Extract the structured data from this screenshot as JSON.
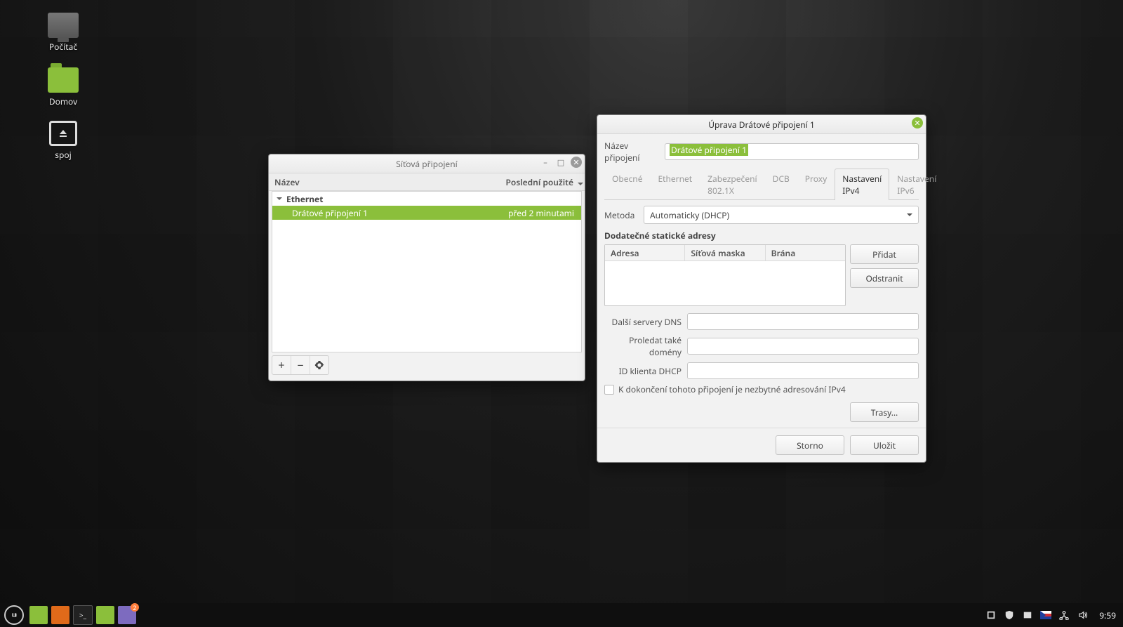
{
  "desktop": {
    "computer": "Počítač",
    "home": "Domov",
    "drive": "spoj"
  },
  "conn_window": {
    "title": "Síťová připojení",
    "col_name": "Název",
    "col_used": "Poslední použité",
    "group": "Ethernet",
    "row_name": "Drátové připojení 1",
    "row_used": "před 2 minutami"
  },
  "edit_window": {
    "title": "Úprava Drátové připojení 1",
    "name_label": "Název připojení",
    "name_value": "Drátové připojení 1",
    "tabs": {
      "general": "Obecné",
      "ethernet": "Ethernet",
      "security": "Zabezpečení 802.1X",
      "dcb": "DCB",
      "proxy": "Proxy",
      "ipv4": "Nastavení IPv4",
      "ipv6": "Nastavení IPv6"
    },
    "method_label": "Metoda",
    "method_value": "Automaticky (DHCP)",
    "static_title": "Dodatečné statické adresy",
    "col_addr": "Adresa",
    "col_mask": "Síťová maska",
    "col_gw": "Brána",
    "btn_add": "Přidat",
    "btn_del": "Odstranit",
    "dns_label": "Další servery DNS",
    "search_label": "Proledat také domény",
    "dhcp_id_label": "ID klienta DHCP",
    "require_v4": "K dokončení tohoto připojení je nezbytné adresování IPv4",
    "routes": "Trasy…",
    "cancel": "Storno",
    "save": "Uložit"
  },
  "taskbar": {
    "app_badge": "2",
    "clock": "9:59"
  }
}
